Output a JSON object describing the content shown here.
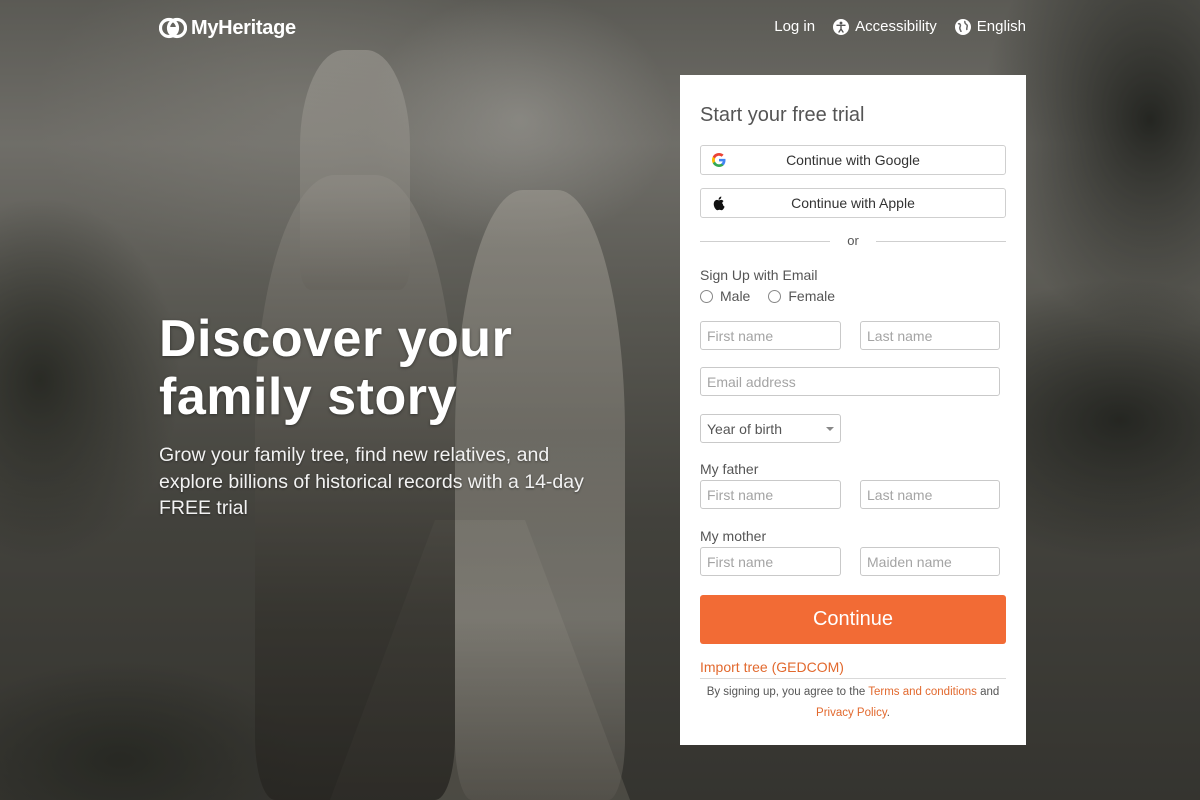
{
  "header": {
    "logo_text": "MyHeritage",
    "nav": {
      "login": "Log in",
      "accessibility": "Accessibility",
      "language": "English"
    }
  },
  "hero": {
    "title_line1": "Discover your",
    "title_line2": "family story",
    "subtitle": "Grow your family tree, find new relatives, and explore billions of historical records with a 14-day FREE trial"
  },
  "signup": {
    "title": "Start your free trial",
    "google_label": "Continue with Google",
    "apple_label": "Continue with Apple",
    "or_label": "or",
    "email_section_label": "Sign Up with Email",
    "gender_options": [
      "Male",
      "Female"
    ],
    "first_name_placeholder": "First name",
    "last_name_placeholder": "Last name",
    "email_placeholder": "Email address",
    "year_of_birth_label": "Year of birth",
    "father_label": "My father",
    "father_first_placeholder": "First name",
    "father_last_placeholder": "Last name",
    "mother_label": "My mother",
    "mother_first_placeholder": "First name",
    "mother_maiden_placeholder": "Maiden name",
    "continue_label": "Continue",
    "import_label": "Import tree (GEDCOM)",
    "legal_prefix": "By signing up, you agree to the",
    "terms_label": "Terms and conditions",
    "legal_and": "and",
    "privacy_label": "Privacy Policy",
    "legal_suffix": "."
  },
  "colors": {
    "accent": "#f26b35",
    "link": "#e2692e",
    "card_bg": "#ffffff"
  },
  "icons": {
    "logo": "myheritage-logo-icon",
    "accessibility": "accessibility-icon",
    "language": "globe-icon",
    "google": "google-g-icon",
    "apple": "apple-icon"
  }
}
